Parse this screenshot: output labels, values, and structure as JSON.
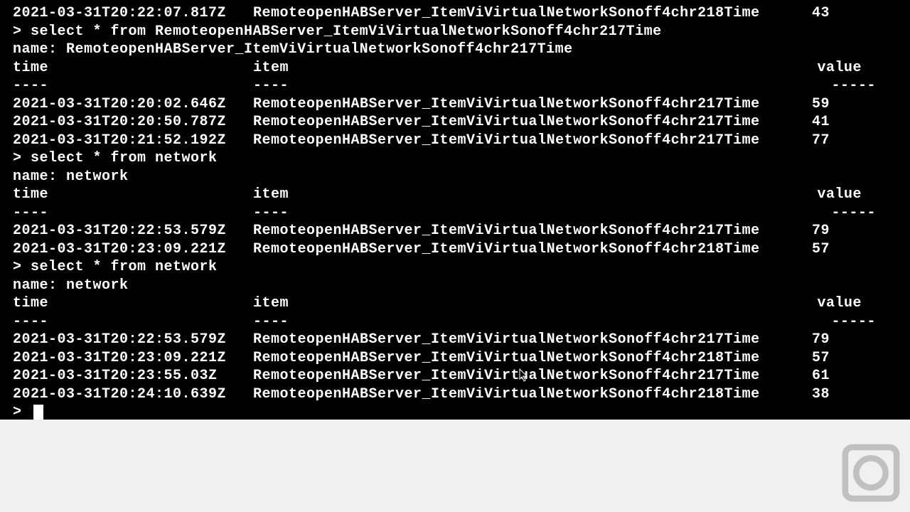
{
  "prompt_char": ">",
  "headers": {
    "time": "time",
    "item": "item",
    "value": "value"
  },
  "dividers": {
    "time": "----",
    "item": "----",
    "value": "-----"
  },
  "lines": [
    {
      "type": "row",
      "time": "2021-03-31T20:22:07.817Z",
      "item": "RemoteopenHABServer_ItemViVirtualNetworkSonoff4chr218Time",
      "value": "43"
    },
    {
      "type": "cmd",
      "text": "select * from RemoteopenHABServer_ItemViVirtualNetworkSonoff4chr217Time"
    },
    {
      "type": "name",
      "text": "name: RemoteopenHABServer_ItemViVirtualNetworkSonoff4chr217Time"
    },
    {
      "type": "header"
    },
    {
      "type": "divider"
    },
    {
      "type": "row",
      "time": "2021-03-31T20:20:02.646Z",
      "item": "RemoteopenHABServer_ItemViVirtualNetworkSonoff4chr217Time",
      "value": "59"
    },
    {
      "type": "row",
      "time": "2021-03-31T20:20:50.787Z",
      "item": "RemoteopenHABServer_ItemViVirtualNetworkSonoff4chr217Time",
      "value": "41"
    },
    {
      "type": "row",
      "time": "2021-03-31T20:21:52.192Z",
      "item": "RemoteopenHABServer_ItemViVirtualNetworkSonoff4chr217Time",
      "value": "77"
    },
    {
      "type": "cmd",
      "text": "select * from network"
    },
    {
      "type": "name",
      "text": "name: network"
    },
    {
      "type": "header"
    },
    {
      "type": "divider"
    },
    {
      "type": "row",
      "time": "2021-03-31T20:22:53.579Z",
      "item": "RemoteopenHABServer_ItemViVirtualNetworkSonoff4chr217Time",
      "value": "79"
    },
    {
      "type": "row",
      "time": "2021-03-31T20:23:09.221Z",
      "item": "RemoteopenHABServer_ItemViVirtualNetworkSonoff4chr218Time",
      "value": "57"
    },
    {
      "type": "cmd",
      "text": "select * from network"
    },
    {
      "type": "name",
      "text": "name: network"
    },
    {
      "type": "header"
    },
    {
      "type": "divider"
    },
    {
      "type": "row",
      "time": "2021-03-31T20:22:53.579Z",
      "item": "RemoteopenHABServer_ItemViVirtualNetworkSonoff4chr217Time",
      "value": "79"
    },
    {
      "type": "row",
      "time": "2021-03-31T20:23:09.221Z",
      "item": "RemoteopenHABServer_ItemViVirtualNetworkSonoff4chr218Time",
      "value": "57"
    },
    {
      "type": "row",
      "time": "2021-03-31T20:23:55.03Z",
      "item": "RemoteopenHABServer_ItemViVirtualNetworkSonoff4chr217Time",
      "value": "61"
    },
    {
      "type": "row",
      "time": "2021-03-31T20:24:10.639Z",
      "item": "RemoteopenHABServer_ItemViVirtualNetworkSonoff4chr218Time",
      "value": "38"
    },
    {
      "type": "prompt"
    }
  ]
}
